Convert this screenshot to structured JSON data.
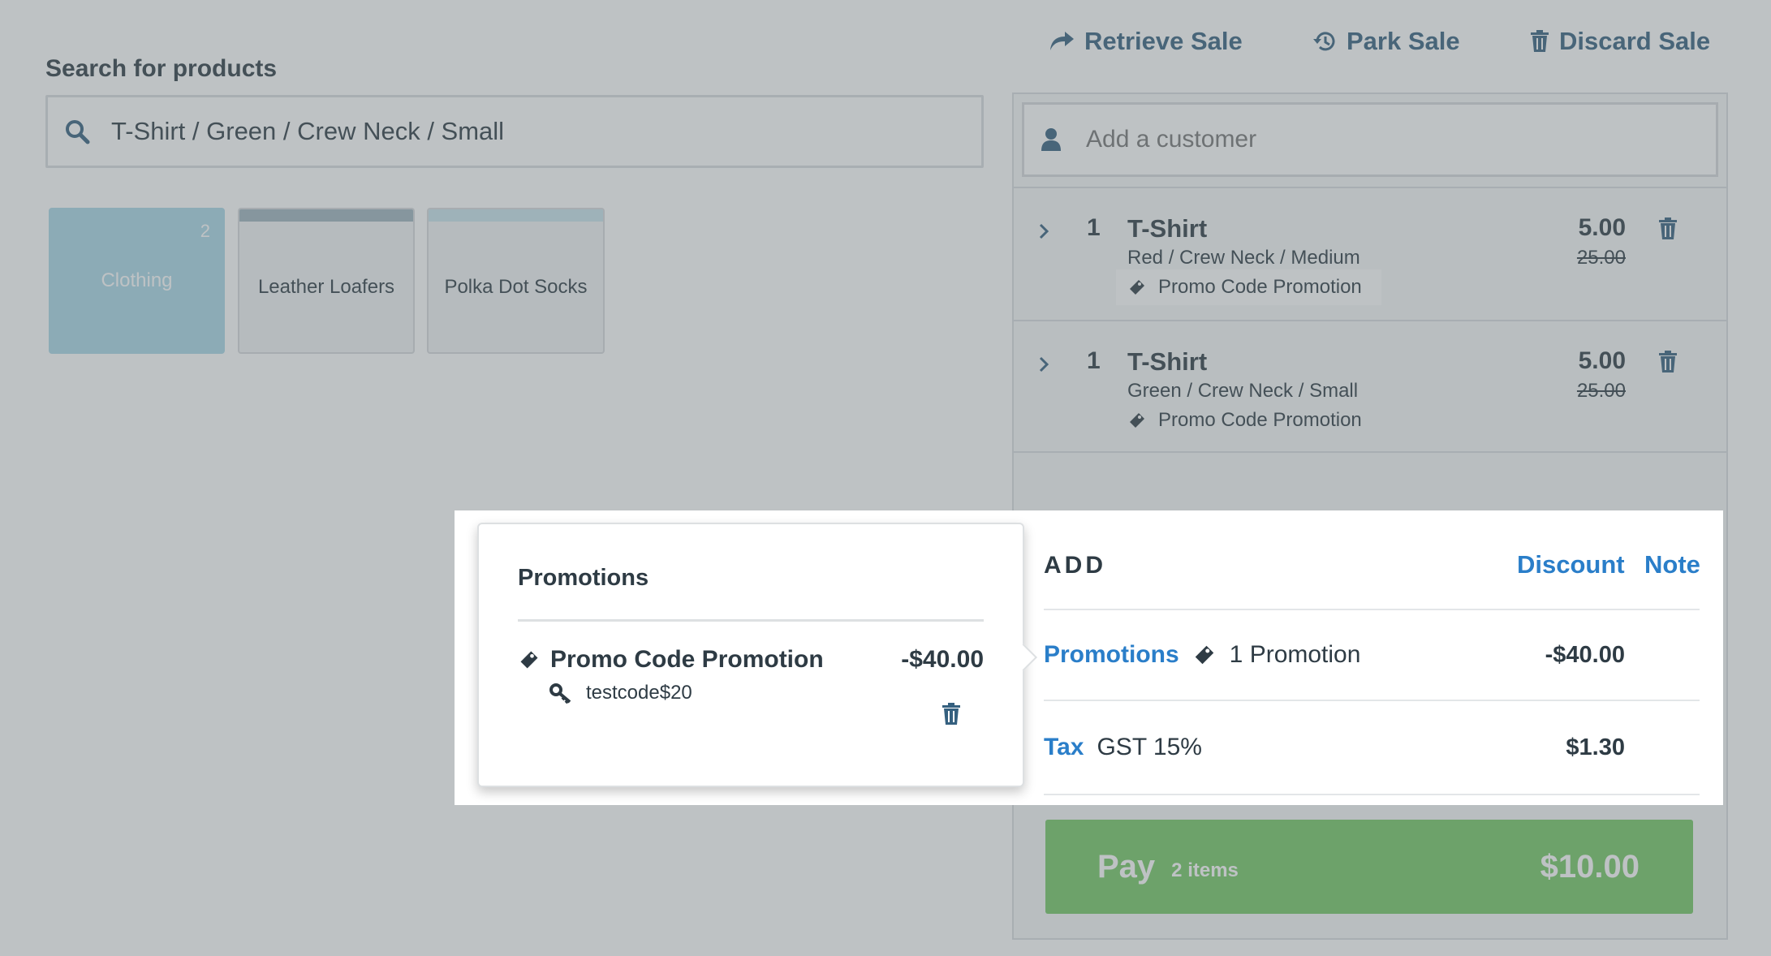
{
  "top_actions": {
    "retrieve_sale": "Retrieve Sale",
    "park_sale": "Park Sale",
    "discard_sale": "Discard Sale"
  },
  "search": {
    "label": "Search for products",
    "value": "T-Shirt / Green / Crew Neck / Small"
  },
  "tiles": [
    {
      "label": "Clothing",
      "count": "2",
      "color": "#a9d7e7"
    },
    {
      "label": "Leather Loafers",
      "color": "#9fb3bd"
    },
    {
      "label": "Polka Dot Socks",
      "color": "#c9e3ec"
    }
  ],
  "customer": {
    "placeholder": "Add a customer"
  },
  "line_items": [
    {
      "qty": "1",
      "name": "T-Shirt",
      "variant": "Red / Crew Neck / Medium",
      "promo": "Promo Code Promotion",
      "price": "5.00",
      "original_price": "25.00"
    },
    {
      "qty": "1",
      "name": "T-Shirt",
      "variant": "Green / Crew Neck / Small",
      "promo": "Promo Code Promotion",
      "price": "5.00",
      "original_price": "25.00"
    }
  ],
  "promotions_popup": {
    "title": "Promotions",
    "promo_name": "Promo Code Promotion",
    "promo_amount": "-$40.00",
    "promo_code": "testcode$20"
  },
  "summary": {
    "add_label": "ADD",
    "discount_link": "Discount",
    "note_link": "Note",
    "promotions_label": "Promotions",
    "promotions_count": "1 Promotion",
    "promotions_value": "-$40.00",
    "tax_label": "Tax",
    "tax_name": "GST 15%",
    "tax_value": "$1.30"
  },
  "pay": {
    "label": "Pay",
    "items": "2 items",
    "total": "$10.00"
  },
  "colors": {
    "accent_blue": "#2a7ec9",
    "pay_green": "#74c864",
    "action_blue": "#35607f",
    "overlay": "rgba(100,110,115,0.42)"
  }
}
